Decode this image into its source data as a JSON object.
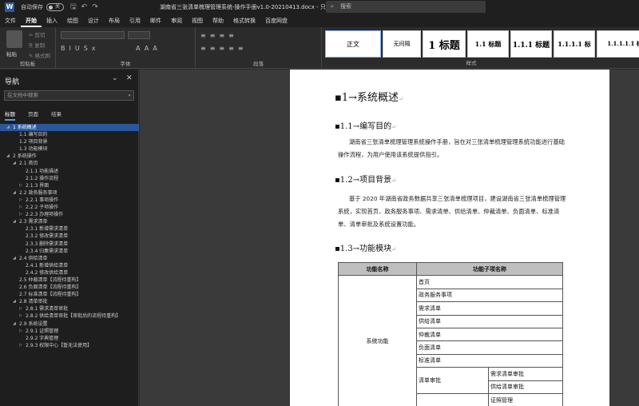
{
  "titlebar": {
    "autosave_label": "自动保存",
    "autosave_state": "关",
    "document_title": "湖南省三张清单梳理管理系统-操作手册v1.0-20210413.docx  -  只读 - 已保存 ∨",
    "search_placeholder": "搜索"
  },
  "menu": [
    "文件",
    "开始",
    "插入",
    "绘图",
    "设计",
    "布局",
    "引用",
    "邮件",
    "审阅",
    "视图",
    "帮助",
    "格式转换",
    "百度网盘"
  ],
  "ribbon": {
    "paste_label": "粘贴",
    "cut_label": "剪切",
    "copy_label": "复制",
    "format_painter_label": "格式刷",
    "groups": {
      "clipboard": "剪贴板",
      "font": "字体",
      "paragraph": "段落",
      "styles": "样式"
    },
    "styles": [
      {
        "label": "正文"
      },
      {
        "label": "无间隔"
      },
      {
        "label": "1 标题"
      },
      {
        "label": "1.1 标题"
      },
      {
        "label": "1.1.1 标题"
      },
      {
        "label": "1.1.1.1 标"
      },
      {
        "label": "1.1.1.1.1 标"
      }
    ]
  },
  "nav": {
    "title": "导航",
    "search_placeholder": "在文档中搜索",
    "tabs": [
      "标题",
      "页面",
      "结果"
    ],
    "items": [
      {
        "label": "1 系统概述",
        "level": 0,
        "arrow": "◢",
        "selected": true
      },
      {
        "label": "1.1 编写目的",
        "level": 1
      },
      {
        "label": "1.2 项目背景",
        "level": 1
      },
      {
        "label": "1.3 功能模块",
        "level": 1
      },
      {
        "label": "2 系统操作",
        "level": 0,
        "arrow": "◢"
      },
      {
        "label": "2.1 首页",
        "level": 1,
        "arrow": "◢"
      },
      {
        "label": "2.1.1 功能描述",
        "level": 2
      },
      {
        "label": "2.1.2 操作流程",
        "level": 2
      },
      {
        "label": "2.1.3 界面",
        "level": 2,
        "arrow": "▷"
      },
      {
        "label": "2.2 政务服务事项",
        "level": 1,
        "arrow": "◢"
      },
      {
        "label": "2.2.1 事项操作",
        "level": 2,
        "arrow": "▷"
      },
      {
        "label": "2.2.2 子项操作",
        "level": 2,
        "arrow": "▷"
      },
      {
        "label": "2.2.3 办理项操作",
        "level": 2,
        "arrow": "▷"
      },
      {
        "label": "2.3 需求清单",
        "level": 1,
        "arrow": "◢"
      },
      {
        "label": "2.3.1 新增需求清单",
        "level": 2
      },
      {
        "label": "2.3.2 修改需求清单",
        "level": 2
      },
      {
        "label": "2.3.3 删除需求清单",
        "level": 2
      },
      {
        "label": "2.3.4 归集需求清单",
        "level": 2
      },
      {
        "label": "2.4 供给清单",
        "level": 1,
        "arrow": "◢"
      },
      {
        "label": "2.4.1 新增供给清单",
        "level": 2
      },
      {
        "label": "2.4.2 修改供给清单",
        "level": 2
      },
      {
        "label": "2.5 仲裁清单【流程待重构】",
        "level": 1
      },
      {
        "label": "2.6 负面清单【流程待重构】",
        "level": 1
      },
      {
        "label": "2.7 标准清单【流程待重构】",
        "level": 1
      },
      {
        "label": "2.8 清单审批",
        "level": 1,
        "arrow": "◢"
      },
      {
        "label": "2.8.1 需求清单审批",
        "level": 2,
        "arrow": "▷"
      },
      {
        "label": "2.8.2 供给清单审批【审批后的流程待重构】",
        "level": 2,
        "arrow": "▷"
      },
      {
        "label": "2.9 系统设置",
        "level": 1,
        "arrow": "◢"
      },
      {
        "label": "2.9.1 证照管理",
        "level": 2,
        "arrow": "▷"
      },
      {
        "label": "2.9.2 字典管理",
        "level": 2
      },
      {
        "label": "2.9.3 权限中心【暂无法使用】",
        "level": 2,
        "arrow": "▷"
      }
    ]
  },
  "doc": {
    "h1": "1→系统概述",
    "s1_title": "1.1→编写目的",
    "s1_text": "湖南省三张清单梳理管理系统操作手册，旨在对三张清单梳理管理系统功能进行基础操作流程，为用户使用该系统提供指引。",
    "s2_title": "1.2→项目背景",
    "s2_text": "基于 2020 年湖南省政务数据共享三张清单梳理项目，建设湖南省三张清单梳理管理系统，实现首页、政务服务事项、需求清单、供给清单、仲裁清单、负面清单、标准清单、清单审批及系统设置功能。",
    "s3_title": "1.3→功能模块",
    "table": {
      "header": [
        "功能名称",
        "功能子项名称"
      ],
      "group_label": "系统功能",
      "rows": [
        "首页",
        "政务服务事项",
        "需求清单",
        "供给清单",
        "仲裁清单",
        "负面清单",
        "标准清单"
      ],
      "approval_label": "清单审批",
      "approval_items": [
        "需求清单审批",
        "供给清单审批"
      ],
      "last_item": "证照管理"
    }
  }
}
